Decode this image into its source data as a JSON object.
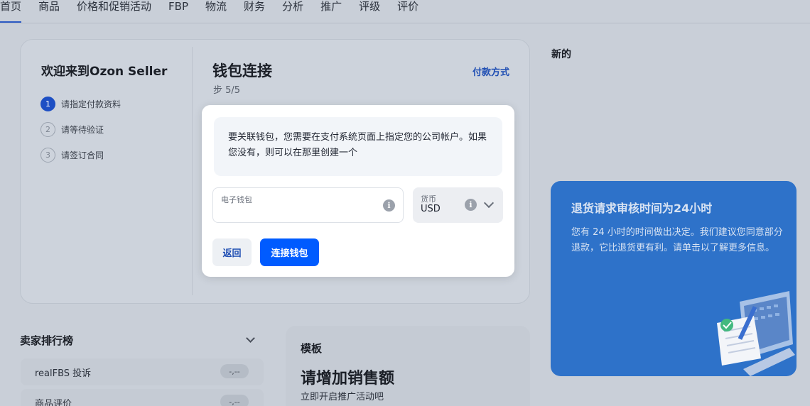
{
  "nav": {
    "tabs": [
      {
        "label": "首页"
      },
      {
        "label": "商品"
      },
      {
        "label": "价格和促销活动"
      },
      {
        "label": "FBP"
      },
      {
        "label": "物流"
      },
      {
        "label": "财务"
      },
      {
        "label": "分析"
      },
      {
        "label": "推广"
      },
      {
        "label": "评级"
      },
      {
        "label": "评价"
      }
    ]
  },
  "onboarding": {
    "welcome_title": "欢迎来到Ozon Seller",
    "steps": [
      {
        "num": "1",
        "label": "请指定付款资料"
      },
      {
        "num": "2",
        "label": "请等待验证"
      },
      {
        "num": "3",
        "label": "请签订合同"
      }
    ],
    "wallet_title": "钱包连接",
    "step_count": "步 5/5",
    "pay_link": "付款方式"
  },
  "modal": {
    "notice": "要关联钱包，您需要在支付系统页面上指定您的公司帐户。如果您没有，则可以在那里创建一个",
    "wallet_field": {
      "label": "电子钱包",
      "value": ""
    },
    "currency_field": {
      "label": "货币",
      "value": "USD"
    },
    "info_glyph": "i",
    "back_label": "返回",
    "connect_label": "连接钱包"
  },
  "news": {
    "title": "新的",
    "promo_title": "退货请求审核时间为24小时",
    "promo_text": "您有 24 小时的时间做出决定。我们建议您同意部分退款，它比退货更有利。请单击以了解更多信息。"
  },
  "ratings": {
    "title": "卖家排行榜",
    "items": [
      {
        "label": "realFBS 投诉",
        "value": "-,--"
      },
      {
        "label": "商品评价",
        "value": "-,--"
      }
    ]
  },
  "template": {
    "label": "模板",
    "title": "请增加销售额",
    "subtitle": "立即开启推广活动吧"
  }
}
